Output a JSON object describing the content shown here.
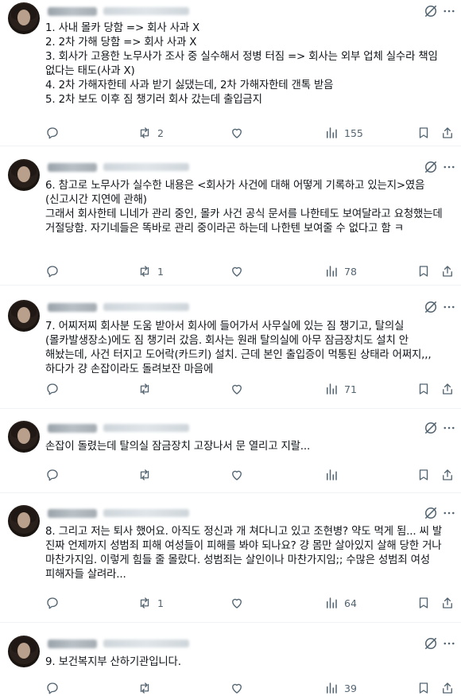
{
  "colors": {
    "icon": "#536471",
    "text": "#0f1419",
    "divider": "#eff3f4"
  },
  "tweets": [
    {
      "text": "1. 사내 몰카 당함 => 회사 사과 X\n2. 2차 가해 당함 => 회사 사과 X\n3. 회사가 고용한 노무사가 조사 중 실수해서 정병 터짐 => 회사는 외부 업체 실수라 책임 없다는 태도(사과 X)\n4. 2차 가해자한테 사과 받기 싫댔는데, 2차 가해자한테 갠톡 받음\n5. 2차 보도 이후 짐 챙기러 회사 갔는데 출입금지",
      "replies": "",
      "reposts": "2",
      "likes": "",
      "views": "155"
    },
    {
      "text": "6. 참고로 노무사가 실수한 내용은 <회사가 사건에 대해 어떻게 기록하고 있는지>였음(신고시간 지연에 관해)\n그래서 회사한테 니네가 관리 중인, 몰카 사건 공식 문서를 나한테도 보여달라고 요청했는데 거절당함. 자기네들은 똑바로 관리 중이라곤 하는데 나한텐 보여줄 수 없다고 함 ㅋ",
      "replies": "",
      "reposts": "1",
      "likes": "",
      "views": "78"
    },
    {
      "text": "7. 어찌저찌 회사분 도움 받아서 회사에 들어가서 사무실에 있는 짐 챙기고, 탈의실(몰카발생장소)에도 짐 챙기러 갔음. 회사는 원래 탈의실에 아무 잠금장치도 설치 안 해놨는데, 사건 터지고 도어락(카드키) 설치. 근데 본인 출입증이 먹통된 상태라 어쩌지,,, 하다가 걍 손잡이라도 돌려보잔 마음에",
      "replies": "",
      "reposts": "",
      "likes": "",
      "views": "71"
    },
    {
      "text": "손잡이 돌렸는데 탈의실 잠금장치 고장나서 문 열리고 지랄...",
      "replies": "",
      "reposts": "",
      "likes": "",
      "views": ""
    },
    {
      "text": "8. 그리고 저는 퇴사 했어요. 아직도 정신과 개 쳐다니고 있고 조현병? 약도 먹게 됨... 씨 발 진짜 언제까지 성범죄 피해 여성들이 피해를 봐야 되나요? 걍 몸만 살아있지 살해 당한 거나 마찬가지임. 이렇게 힘들 줄 몰랐다. 성범죄는 살인이나 마찬가지임;; 수많은 성범죄 여성 피해자들 살려라...",
      "replies": "",
      "reposts": "1",
      "likes": "",
      "views": "64"
    },
    {
      "text": "9. 보건복지부 산하기관입니다.",
      "replies": "",
      "reposts": "",
      "likes": "",
      "views": "39"
    }
  ]
}
